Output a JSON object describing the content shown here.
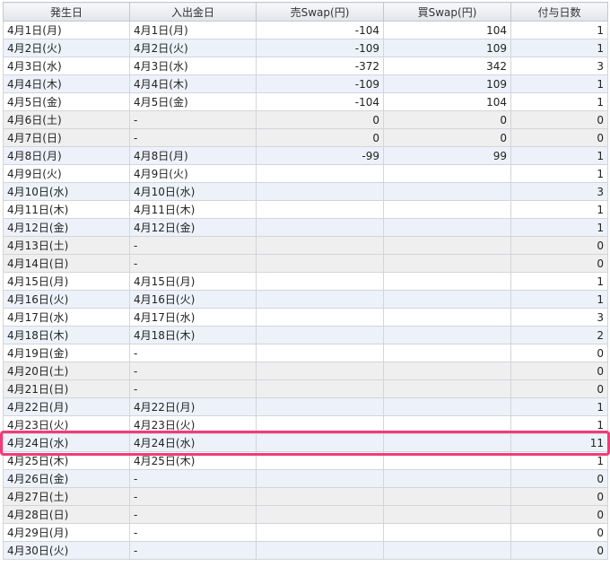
{
  "headers": [
    "発生日",
    "入出金日",
    "売Swap(円)",
    "買Swap(円)",
    "付与日数"
  ],
  "highlight_color": "#f23b78",
  "rows": [
    {
      "date": "4月1日(月)",
      "pay_date": "4月1日(月)",
      "sell": "-104",
      "buy": "104",
      "days": "1",
      "weekend": false
    },
    {
      "date": "4月2日(火)",
      "pay_date": "4月2日(火)",
      "sell": "-109",
      "buy": "109",
      "days": "1",
      "weekend": false
    },
    {
      "date": "4月3日(水)",
      "pay_date": "4月3日(水)",
      "sell": "-372",
      "buy": "342",
      "days": "3",
      "weekend": false
    },
    {
      "date": "4月4日(木)",
      "pay_date": "4月4日(木)",
      "sell": "-109",
      "buy": "109",
      "days": "1",
      "weekend": false
    },
    {
      "date": "4月5日(金)",
      "pay_date": "4月5日(金)",
      "sell": "-104",
      "buy": "104",
      "days": "1",
      "weekend": false
    },
    {
      "date": "4月6日(土)",
      "pay_date": "-",
      "sell": "0",
      "buy": "0",
      "days": "0",
      "weekend": true
    },
    {
      "date": "4月7日(日)",
      "pay_date": "-",
      "sell": "0",
      "buy": "0",
      "days": "0",
      "weekend": true
    },
    {
      "date": "4月8日(月)",
      "pay_date": "4月8日(月)",
      "sell": "-99",
      "buy": "99",
      "days": "1",
      "weekend": false
    },
    {
      "date": "4月9日(火)",
      "pay_date": "4月9日(火)",
      "sell": "",
      "buy": "",
      "days": "1",
      "weekend": false
    },
    {
      "date": "4月10日(水)",
      "pay_date": "4月10日(水)",
      "sell": "",
      "buy": "",
      "days": "3",
      "weekend": false
    },
    {
      "date": "4月11日(木)",
      "pay_date": "4月11日(木)",
      "sell": "",
      "buy": "",
      "days": "1",
      "weekend": false
    },
    {
      "date": "4月12日(金)",
      "pay_date": "4月12日(金)",
      "sell": "",
      "buy": "",
      "days": "1",
      "weekend": false
    },
    {
      "date": "4月13日(土)",
      "pay_date": "-",
      "sell": "",
      "buy": "",
      "days": "0",
      "weekend": true
    },
    {
      "date": "4月14日(日)",
      "pay_date": "-",
      "sell": "",
      "buy": "",
      "days": "0",
      "weekend": true
    },
    {
      "date": "4月15日(月)",
      "pay_date": "4月15日(月)",
      "sell": "",
      "buy": "",
      "days": "1",
      "weekend": false
    },
    {
      "date": "4月16日(火)",
      "pay_date": "4月16日(火)",
      "sell": "",
      "buy": "",
      "days": "1",
      "weekend": false
    },
    {
      "date": "4月17日(水)",
      "pay_date": "4月17日(水)",
      "sell": "",
      "buy": "",
      "days": "3",
      "weekend": false
    },
    {
      "date": "4月18日(木)",
      "pay_date": "4月18日(木)",
      "sell": "",
      "buy": "",
      "days": "2",
      "weekend": false
    },
    {
      "date": "4月19日(金)",
      "pay_date": "-",
      "sell": "",
      "buy": "",
      "days": "0",
      "weekend": false
    },
    {
      "date": "4月20日(土)",
      "pay_date": "-",
      "sell": "",
      "buy": "",
      "days": "0",
      "weekend": true
    },
    {
      "date": "4月21日(日)",
      "pay_date": "-",
      "sell": "",
      "buy": "",
      "days": "0",
      "weekend": true
    },
    {
      "date": "4月22日(月)",
      "pay_date": "4月22日(月)",
      "sell": "",
      "buy": "",
      "days": "1",
      "weekend": false
    },
    {
      "date": "4月23日(火)",
      "pay_date": "4月23日(火)",
      "sell": "",
      "buy": "",
      "days": "1",
      "weekend": false
    },
    {
      "date": "4月24日(水)",
      "pay_date": "4月24日(水)",
      "sell": "",
      "buy": "",
      "days": "11",
      "weekend": false,
      "highlighted": true
    },
    {
      "date": "4月25日(木)",
      "pay_date": "4月25日(木)",
      "sell": "",
      "buy": "",
      "days": "1",
      "weekend": false
    },
    {
      "date": "4月26日(金)",
      "pay_date": "-",
      "sell": "",
      "buy": "",
      "days": "0",
      "weekend": false
    },
    {
      "date": "4月27日(土)",
      "pay_date": "-",
      "sell": "",
      "buy": "",
      "days": "0",
      "weekend": true
    },
    {
      "date": "4月28日(日)",
      "pay_date": "-",
      "sell": "",
      "buy": "",
      "days": "0",
      "weekend": true
    },
    {
      "date": "4月29日(月)",
      "pay_date": "-",
      "sell": "",
      "buy": "",
      "days": "0",
      "weekend": false
    },
    {
      "date": "4月30日(火)",
      "pay_date": "-",
      "sell": "",
      "buy": "",
      "days": "0",
      "weekend": false
    }
  ]
}
